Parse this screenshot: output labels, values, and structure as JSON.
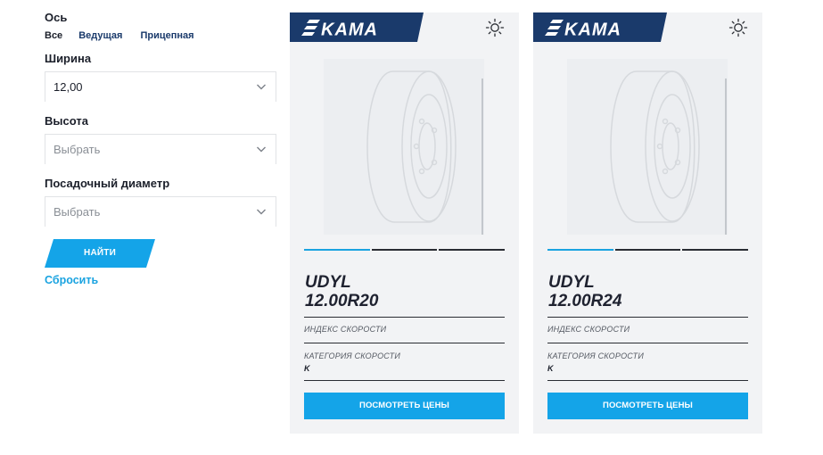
{
  "filters": {
    "axle": {
      "label": "Ось",
      "options": [
        "Все",
        "Ведущая",
        "Прицепная"
      ],
      "selected": "Все"
    },
    "width": {
      "label": "Ширина",
      "value": "12,00"
    },
    "height": {
      "label": "Высота",
      "placeholder": "Выбрать"
    },
    "diameter": {
      "label": "Посадочный диаметр",
      "placeholder": "Выбрать"
    },
    "find_label": "НАЙТИ",
    "reset_label": "Сбросить"
  },
  "colors": {
    "brand_navy": "#1a3a6b",
    "accent_blue": "#14a4e8",
    "card_bg": "#f2f3f5"
  },
  "products": [
    {
      "brand": "KAMA",
      "model": "UDYL",
      "size": "12.00R20",
      "speed_index_label": "ИНДЕКС СКОРОСТИ",
      "speed_index_value": "",
      "speed_category_label": "КАТЕГОРИЯ СКОРОСТИ",
      "speed_category_value": "K",
      "season_icon": "sun-icon",
      "button_label": "ПОСМОТРЕТЬ ЦЕНЫ",
      "slides": 3,
      "active_slide": 1
    },
    {
      "brand": "KAMA",
      "model": "UDYL",
      "size": "12.00R24",
      "speed_index_label": "ИНДЕКС СКОРОСТИ",
      "speed_index_value": "",
      "speed_category_label": "КАТЕГОРИЯ СКОРОСТИ",
      "speed_category_value": "K",
      "season_icon": "sun-icon",
      "button_label": "ПОСМОТРЕТЬ ЦЕНЫ",
      "slides": 3,
      "active_slide": 1
    }
  ]
}
